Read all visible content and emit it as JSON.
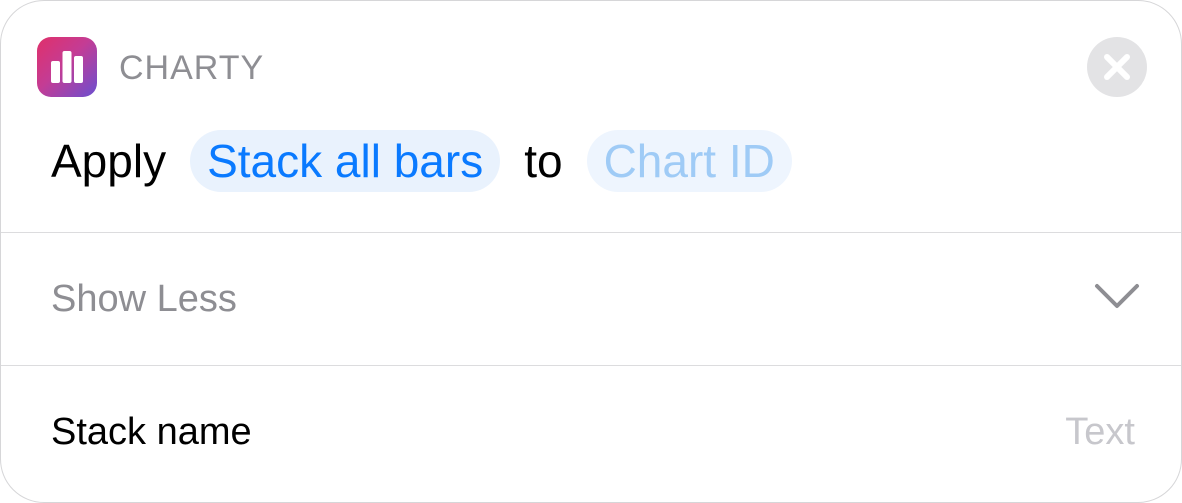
{
  "header": {
    "app_name": "CHARTY",
    "app_icon": "bar-chart-icon",
    "close_icon": "close-icon",
    "brand_gradient": [
      "#e0306a",
      "#c43c94",
      "#6b4fd0"
    ]
  },
  "action": {
    "verb": "Apply",
    "action_token": "Stack all bars",
    "connector": "to",
    "param_token": "Chart ID",
    "accent_color": "#0a7aff"
  },
  "toggle": {
    "label": "Show Less",
    "icon": "chevron-down-icon"
  },
  "parameters": [
    {
      "label": "Stack name",
      "placeholder": "Text",
      "value": ""
    }
  ]
}
